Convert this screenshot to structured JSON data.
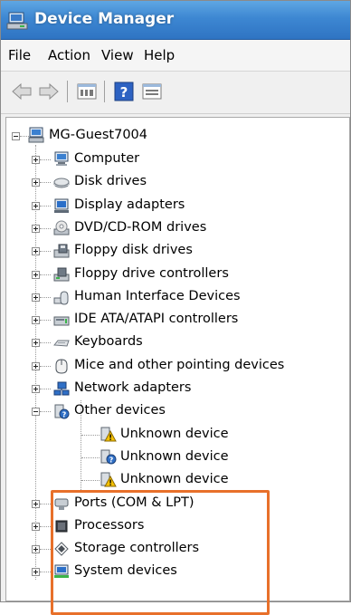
{
  "window": {
    "title": "Device Manager"
  },
  "menu": [
    "File",
    "Action",
    "View",
    "Help"
  ],
  "toolbar": {
    "buttons": [
      "back-arrow-icon",
      "forward-arrow-icon",
      "properties-icon",
      "help-icon",
      "view-icon"
    ]
  },
  "tree": {
    "root": "MG-Guest7004",
    "categories": [
      {
        "label": "Computer",
        "icon": "computer-icon"
      },
      {
        "label": "Disk drives",
        "icon": "disk-drive-icon"
      },
      {
        "label": "Display adapters",
        "icon": "display-adapter-icon"
      },
      {
        "label": "DVD/CD-ROM drives",
        "icon": "dvd-drive-icon"
      },
      {
        "label": "Floppy disk drives",
        "icon": "floppy-drive-icon"
      },
      {
        "label": "Floppy drive controllers",
        "icon": "floppy-controller-icon"
      },
      {
        "label": "Human Interface Devices",
        "icon": "hid-icon"
      },
      {
        "label": "IDE ATA/ATAPI controllers",
        "icon": "ide-controller-icon"
      },
      {
        "label": "Keyboards",
        "icon": "keyboard-icon"
      },
      {
        "label": "Mice and other pointing devices",
        "icon": "mouse-icon"
      },
      {
        "label": "Network adapters",
        "icon": "network-adapter-icon"
      },
      {
        "label": "Other devices",
        "icon": "unknown-device-icon",
        "expanded": true,
        "children": [
          "Unknown device",
          "Unknown device",
          "Unknown device"
        ]
      },
      {
        "label": "Ports (COM & LPT)",
        "icon": "port-icon"
      },
      {
        "label": "Processors",
        "icon": "processor-icon"
      },
      {
        "label": "Storage controllers",
        "icon": "storage-controller-icon"
      },
      {
        "label": "System devices",
        "icon": "system-devices-icon"
      }
    ]
  },
  "colors": {
    "titlebar": "#3d87d2",
    "highlight": "#e8702a",
    "warning": "#f4c000"
  }
}
